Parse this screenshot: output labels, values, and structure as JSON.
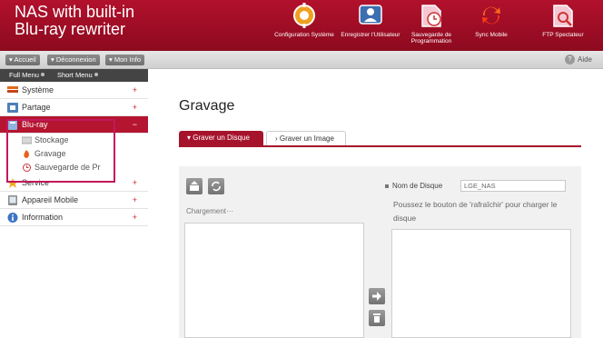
{
  "header": {
    "brand_line1": "NAS with built-in",
    "brand_line2": "Blu-ray rewriter",
    "nav": [
      {
        "label": "Configuration Système",
        "icon": "gear-icon"
      },
      {
        "label": "Enregistrer l'Utilisateur",
        "icon": "user-icon"
      },
      {
        "label": "Sauvegarde de Programmation",
        "icon": "schedule-icon"
      },
      {
        "label": "Sync Mobile",
        "icon": "sync-icon"
      },
      {
        "label": "FTP Spectateur",
        "icon": "ftp-icon"
      }
    ]
  },
  "toolbar": {
    "accueil": "Accueil",
    "deconnexion": "Déconnexion",
    "mon_info": "Mon Info",
    "aide": "Aide"
  },
  "sidebar": {
    "full_menu": "Full Menu",
    "short_menu": "Short Menu",
    "items": [
      {
        "label": "Système"
      },
      {
        "label": "Partage"
      },
      {
        "label": "Blu-ray"
      },
      {
        "label": "Service"
      },
      {
        "label": "Appareil Mobile"
      },
      {
        "label": "Information"
      }
    ],
    "subitems": [
      {
        "label": "Stockage"
      },
      {
        "label": "Gravage"
      },
      {
        "label": "Sauvegarde de Pr"
      }
    ],
    "plus": "+",
    "minus": "−"
  },
  "main": {
    "title": "Gravage",
    "tabs": [
      {
        "label": "Graver un Disque"
      },
      {
        "label": "Graver un Image"
      }
    ],
    "loading": "Chargement···",
    "disc_name_label": "Nom de Disque",
    "disc_name_value": "LGE_NAS",
    "refresh_hint": "Poussez le bouton de 'rafraîchir' pour charger le disque"
  },
  "colors": {
    "brand": "#a6142c",
    "highlight": "#c2185b"
  }
}
